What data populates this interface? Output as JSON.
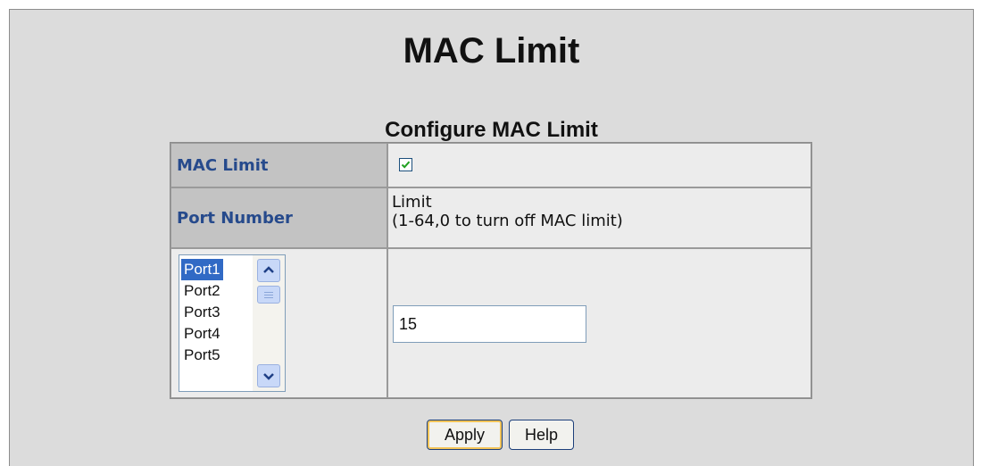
{
  "page": {
    "title": "MAC Limit",
    "section_title": "Configure MAC Limit"
  },
  "table": {
    "mac_limit_label": "MAC Limit",
    "mac_limit_checked": true,
    "port_number_label": "Port Number",
    "limit_header_line1": "Limit",
    "limit_header_line2": "(1-64,0 to turn off MAC limit)"
  },
  "port_list": {
    "items": [
      "Port1",
      "Port2",
      "Port3",
      "Port4",
      "Port5"
    ],
    "selected": "Port1"
  },
  "limit_input": {
    "value": "15"
  },
  "buttons": {
    "apply": "Apply",
    "help": "Help"
  },
  "icons": {
    "checkbox": "check-icon",
    "scroll_up": "chevron-up-icon",
    "scroll_down": "chevron-down-icon"
  },
  "colors": {
    "label_text": "#264a8c",
    "selection": "#316ac5",
    "label_bg": "#c3c3c3"
  }
}
